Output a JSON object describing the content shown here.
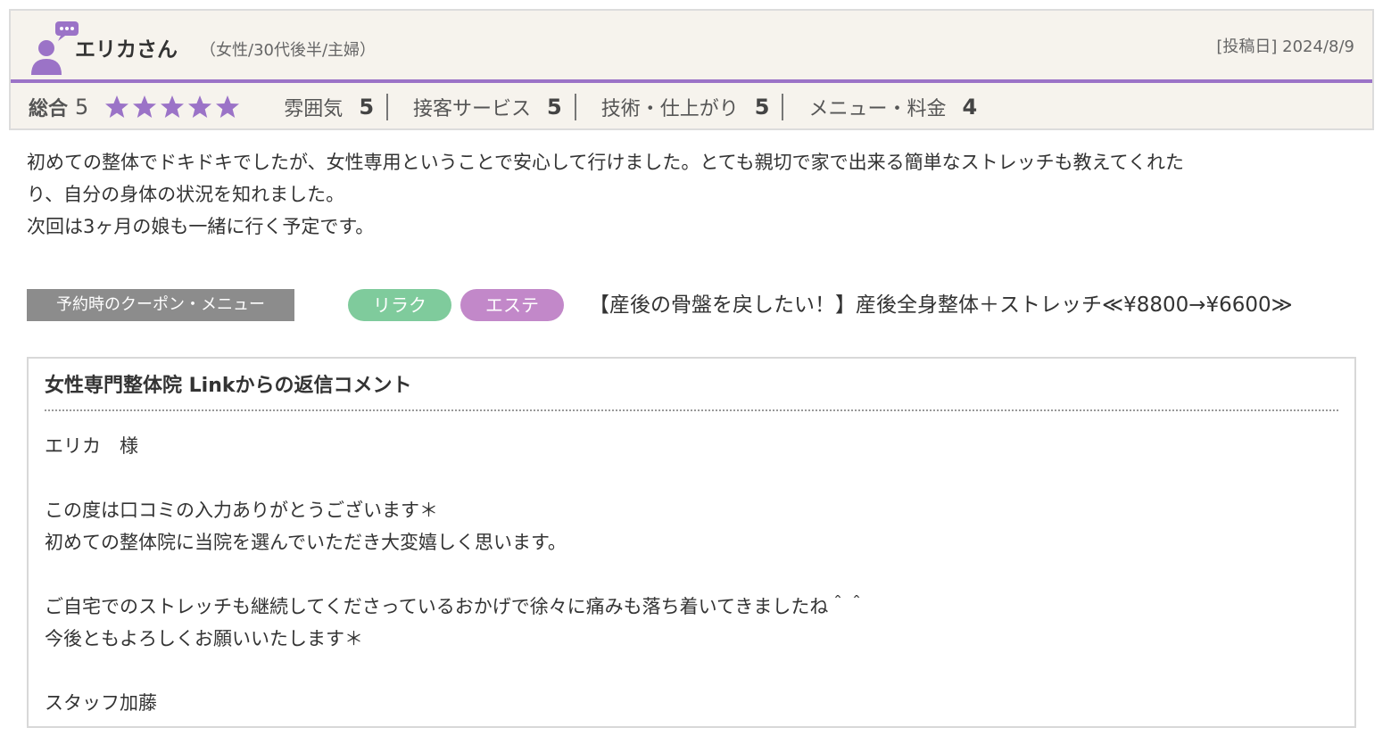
{
  "review": {
    "user_name": "エリカさん",
    "user_meta": "（女性/30代後半/主婦）",
    "post_date": "[投稿日] 2024/8/9",
    "total_label": "総合",
    "total_score": "5",
    "stars_filled": 5,
    "stars_total": 5,
    "colors": {
      "accent": "#9b73c7",
      "star": "#9b73c7",
      "header_bg": "#f6f3ed"
    },
    "categories": [
      {
        "label": "雰囲気",
        "score": "5"
      },
      {
        "label": "接客サービス",
        "score": "5"
      },
      {
        "label": "技術・仕上がり",
        "score": "5"
      },
      {
        "label": "メニュー・料金",
        "score": "4"
      }
    ],
    "body_lines": [
      "初めての整体でドキドキでしたが、女性専用ということで安心して行けました。とても親切で家で出来る簡単なストレッチも教えてくれた",
      "り、自分の身体の状況を知れました。",
      "次回は3ヶ月の娘も一緒に行く予定です。"
    ],
    "coupon": {
      "label": "予約時のクーポン・メニュー",
      "tags": [
        "リラク",
        "エステ"
      ],
      "tag_colors": [
        "#7fcb9c",
        "#c288c9"
      ],
      "name": "【産後の骨盤を戻したい！】産後全身整体＋ストレッチ≪¥8800→¥6600≫"
    }
  },
  "reply": {
    "title": "女性専門整体院 Linkからの返信コメント",
    "lines": [
      "エリカ　様",
      "",
      "この度は口コミの入力ありがとうございます＊",
      "初めての整体院に当院を選んでいただき大変嬉しく思います。",
      "",
      "ご自宅でのストレッチも継続してくださっているおかげで徐々に痛みも落ち着いてきましたね＾＾",
      "今後ともよろしくお願いいたします＊",
      "",
      "スタッフ加藤"
    ]
  }
}
